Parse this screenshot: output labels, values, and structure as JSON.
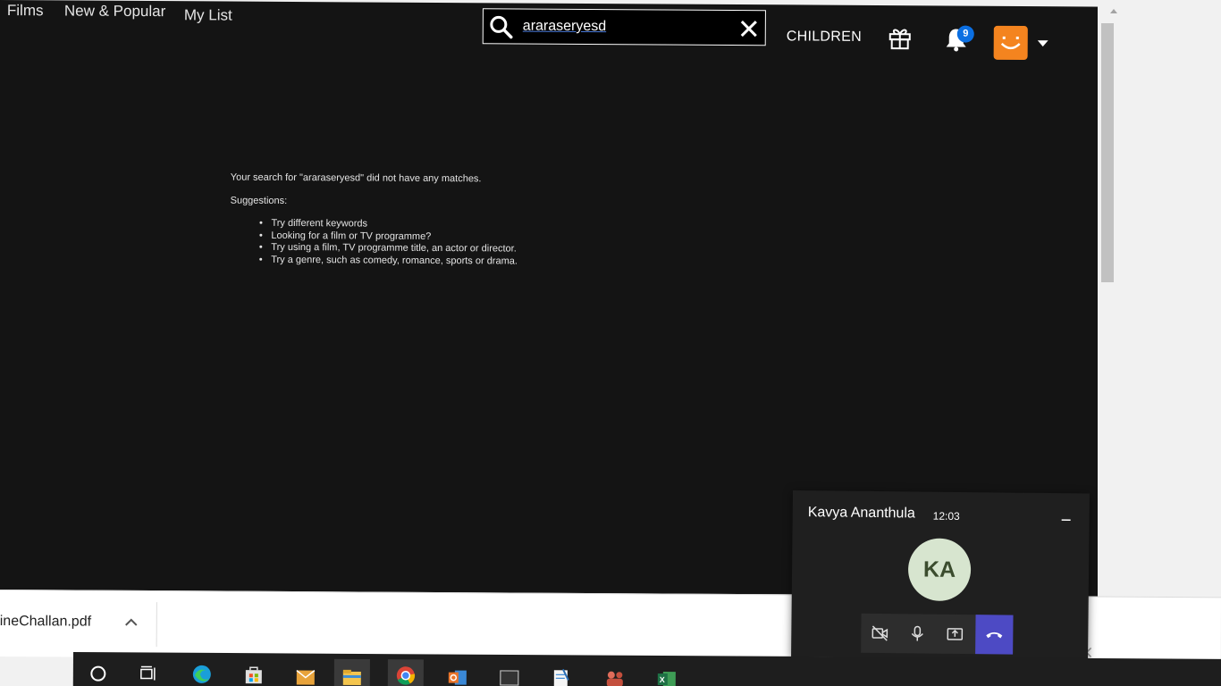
{
  "nav": {
    "films": "Films",
    "new_popular": "New & Popular",
    "my_list": "My List"
  },
  "search": {
    "value": "araraseryesd",
    "clear_icon": "close-icon",
    "icon": "search-icon"
  },
  "header": {
    "children_label": "CHILDREN",
    "gift_icon": "gift-icon",
    "bell_icon": "bell-icon",
    "notification_count": "9",
    "profile_icon": "profile-avatar",
    "caret_icon": "caret-down-icon"
  },
  "results": {
    "message": "Your search for \"araraseryesd\" did not have any matches.",
    "suggestions_title": "Suggestions:",
    "suggestions": [
      "Try different keywords",
      "Looking for a film or TV programme?",
      "Try using a film, TV programme title, an actor or director.",
      "Try a genre, such as comedy, romance, sports or drama."
    ]
  },
  "download_bar": {
    "file_name": "ineChallan.pdf"
  },
  "call": {
    "caller_name": "Kavya Ananthula",
    "duration": "12:03",
    "initials": "KA"
  },
  "colors": {
    "background": "#141414",
    "accent_orange": "#f4841f",
    "badge_blue": "#0b6fe2",
    "hangup_purple": "#4d4ac4",
    "avatar_green": "#d7e5cf"
  }
}
